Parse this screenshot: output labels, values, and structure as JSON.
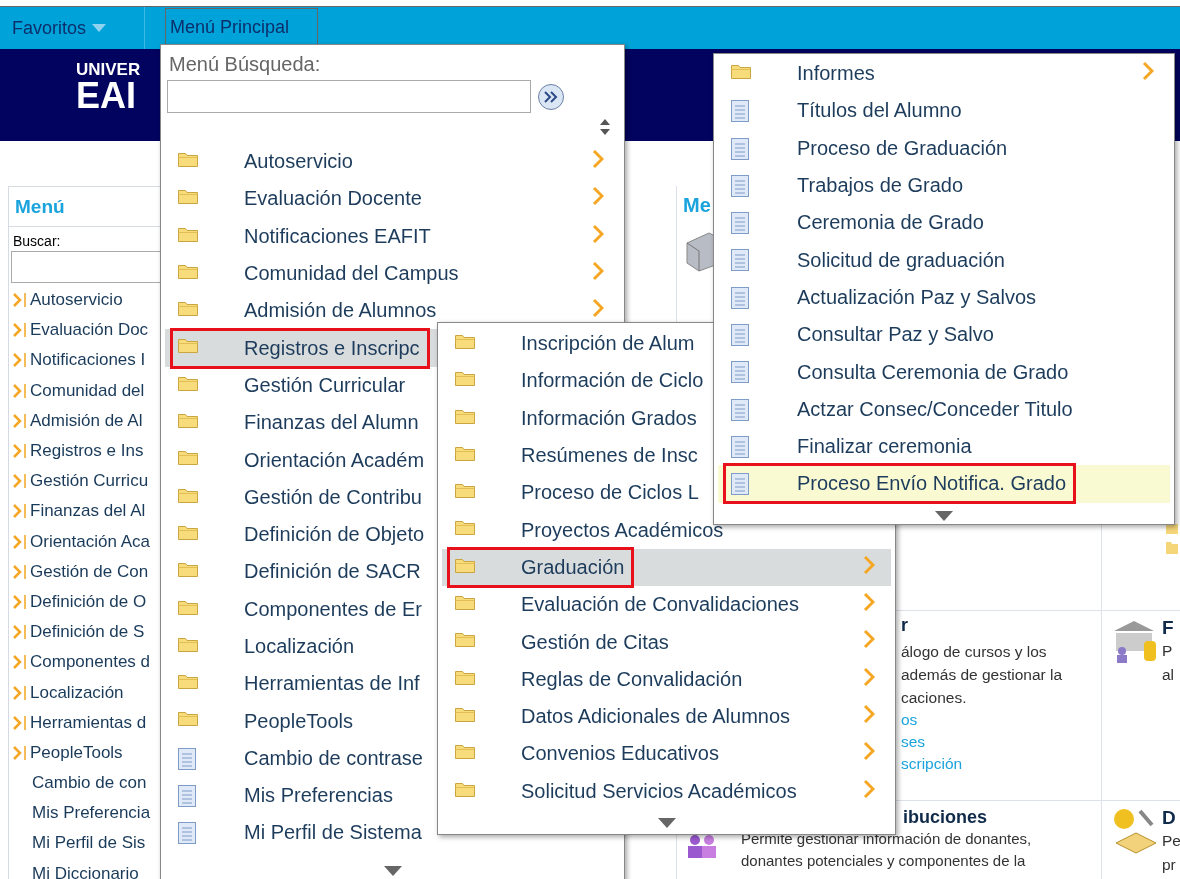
{
  "top_bar": {
    "favorites": "Favoritos",
    "main_menu_tab": "Menú Principal"
  },
  "banner": {
    "logo_lines": [
      "UNIVER",
      "EAI"
    ]
  },
  "sidebar": {
    "title": "Menú",
    "search_label": "Buscar:",
    "items": [
      {
        "label": "Autoservicio",
        "kind": "folder"
      },
      {
        "label": "Evaluación Doc",
        "kind": "folder"
      },
      {
        "label": "Notificaciones I",
        "kind": "folder"
      },
      {
        "label": "Comunidad del",
        "kind": "folder"
      },
      {
        "label": "Admisión de Al",
        "kind": "folder"
      },
      {
        "label": "Registros e Ins",
        "kind": "folder"
      },
      {
        "label": "Gestión Curricu",
        "kind": "folder"
      },
      {
        "label": "Finanzas del Al",
        "kind": "folder"
      },
      {
        "label": "Orientación Aca",
        "kind": "folder"
      },
      {
        "label": "Gestión de Con",
        "kind": "folder"
      },
      {
        "label": "Definición de O",
        "kind": "folder"
      },
      {
        "label": "Definición de S",
        "kind": "folder"
      },
      {
        "label": "Componentes d",
        "kind": "folder"
      },
      {
        "label": "Localización",
        "kind": "folder"
      },
      {
        "label": "Herramientas d",
        "kind": "folder"
      },
      {
        "label": "PeopleTools",
        "kind": "folder"
      },
      {
        "label": "Cambio de con",
        "kind": "page"
      },
      {
        "label": "Mis Preferencia",
        "kind": "page"
      },
      {
        "label": "Mi Perfil de Sis",
        "kind": "page"
      },
      {
        "label": "Mi Diccionario",
        "kind": "page"
      }
    ]
  },
  "portal": {
    "portlet_title": "Me",
    "catalog": {
      "title": "r",
      "lines": [
        "álogo de cursos y los",
        "además de gestionar la",
        "caciones."
      ],
      "links": [
        "os",
        "ses",
        "scripción"
      ]
    },
    "donations": {
      "title": "ibuciones",
      "lines": [
        "Permite gestionar información de donantes,",
        "donantes potenciales y componentes de la"
      ]
    },
    "side_top": {
      "title": "F",
      "lines": [
        "P",
        "al"
      ]
    },
    "side_bottom": {
      "title": "D",
      "lines": [
        "Pe",
        "pr"
      ]
    }
  },
  "main_menu": {
    "search_label": "Menú Búsqueda:",
    "items": [
      {
        "label": "Autoservicio",
        "kind": "folder",
        "submenu": true,
        "selected": false,
        "marked": false
      },
      {
        "label": "Evaluación Docente",
        "kind": "folder",
        "submenu": true,
        "selected": false,
        "marked": false
      },
      {
        "label": "Notificaciones EAFIT",
        "kind": "folder",
        "submenu": true,
        "selected": false,
        "marked": false
      },
      {
        "label": "Comunidad del Campus",
        "kind": "folder",
        "submenu": true,
        "selected": false,
        "marked": false
      },
      {
        "label": "Admisión de Alumnos",
        "kind": "folder",
        "submenu": true,
        "selected": false,
        "marked": false
      },
      {
        "label": "Registros e Inscripc",
        "kind": "folder",
        "submenu": false,
        "selected": true,
        "marked": true
      },
      {
        "label": "Gestión Curricular",
        "kind": "folder",
        "submenu": false,
        "selected": false,
        "marked": false
      },
      {
        "label": "Finanzas del Alumn",
        "kind": "folder",
        "submenu": false,
        "selected": false,
        "marked": false
      },
      {
        "label": "Orientación Académ",
        "kind": "folder",
        "submenu": false,
        "selected": false,
        "marked": false
      },
      {
        "label": "Gestión de Contribu",
        "kind": "folder",
        "submenu": false,
        "selected": false,
        "marked": false
      },
      {
        "label": "Definición de Objeto",
        "kind": "folder",
        "submenu": false,
        "selected": false,
        "marked": false
      },
      {
        "label": "Definición de SACR",
        "kind": "folder",
        "submenu": false,
        "selected": false,
        "marked": false
      },
      {
        "label": "Componentes de Er",
        "kind": "folder",
        "submenu": false,
        "selected": false,
        "marked": false
      },
      {
        "label": "Localización",
        "kind": "folder",
        "submenu": false,
        "selected": false,
        "marked": false
      },
      {
        "label": "Herramientas de Inf",
        "kind": "folder",
        "submenu": false,
        "selected": false,
        "marked": false
      },
      {
        "label": "PeopleTools",
        "kind": "folder",
        "submenu": false,
        "selected": false,
        "marked": false
      },
      {
        "label": "Cambio de contrase",
        "kind": "page",
        "submenu": false,
        "selected": false,
        "marked": false
      },
      {
        "label": "Mis Preferencias",
        "kind": "page",
        "submenu": false,
        "selected": false,
        "marked": false
      },
      {
        "label": "Mi Perfil de Sistema",
        "kind": "page",
        "submenu": false,
        "selected": false,
        "marked": false
      }
    ]
  },
  "submenu": {
    "items": [
      {
        "label": "Inscripción de Alum",
        "kind": "folder",
        "submenu": false,
        "selected": false,
        "marked": false
      },
      {
        "label": "Información de Ciclo",
        "kind": "folder",
        "submenu": false,
        "selected": false,
        "marked": false
      },
      {
        "label": "Información Grados",
        "kind": "folder",
        "submenu": false,
        "selected": false,
        "marked": false
      },
      {
        "label": "Resúmenes de Insc",
        "kind": "folder",
        "submenu": false,
        "selected": false,
        "marked": false
      },
      {
        "label": "Proceso de Ciclos L",
        "kind": "folder",
        "submenu": false,
        "selected": false,
        "marked": false
      },
      {
        "label": "Proyectos Académicos",
        "kind": "folder",
        "submenu": false,
        "selected": false,
        "marked": false
      },
      {
        "label": "Graduación",
        "kind": "folder",
        "submenu": true,
        "selected": true,
        "marked": true
      },
      {
        "label": "Evaluación de Convalidaciones",
        "kind": "folder",
        "submenu": true,
        "selected": false,
        "marked": false
      },
      {
        "label": "Gestión de Citas",
        "kind": "folder",
        "submenu": true,
        "selected": false,
        "marked": false
      },
      {
        "label": "Reglas de Convalidación",
        "kind": "folder",
        "submenu": true,
        "selected": false,
        "marked": false
      },
      {
        "label": "Datos Adicionales de Alumnos",
        "kind": "folder",
        "submenu": true,
        "selected": false,
        "marked": false
      },
      {
        "label": "Convenios Educativos",
        "kind": "folder",
        "submenu": true,
        "selected": false,
        "marked": false
      },
      {
        "label": "Solicitud Servicios Académicos",
        "kind": "folder",
        "submenu": true,
        "selected": false,
        "marked": false
      }
    ]
  },
  "graduation_menu": {
    "items": [
      {
        "label": "Informes",
        "kind": "folder",
        "submenu": true,
        "selected": false,
        "marked": false
      },
      {
        "label": "Títulos del Alumno",
        "kind": "page",
        "submenu": false,
        "selected": false,
        "marked": false
      },
      {
        "label": "Proceso de Graduación",
        "kind": "page",
        "submenu": false,
        "selected": false,
        "marked": false
      },
      {
        "label": "Trabajos de Grado",
        "kind": "page",
        "submenu": false,
        "selected": false,
        "marked": false
      },
      {
        "label": "Ceremonia de Grado",
        "kind": "page",
        "submenu": false,
        "selected": false,
        "marked": false
      },
      {
        "label": "Solicitud de graduación",
        "kind": "page",
        "submenu": false,
        "selected": false,
        "marked": false
      },
      {
        "label": "Actualización Paz y Salvos",
        "kind": "page",
        "submenu": false,
        "selected": false,
        "marked": false
      },
      {
        "label": "Consultar Paz y Salvo",
        "kind": "page",
        "submenu": false,
        "selected": false,
        "marked": false
      },
      {
        "label": "Consulta Ceremonia de Grado",
        "kind": "page",
        "submenu": false,
        "selected": false,
        "marked": false
      },
      {
        "label": "Actzar Consec/Conceder Titulo",
        "kind": "page",
        "submenu": false,
        "selected": false,
        "marked": false
      },
      {
        "label": "Finalizar ceremonia",
        "kind": "page",
        "submenu": false,
        "selected": false,
        "marked": false
      },
      {
        "label": "Proceso Envío Notifica. Grado",
        "kind": "page",
        "submenu": false,
        "selected": true,
        "marked": true
      }
    ]
  }
}
